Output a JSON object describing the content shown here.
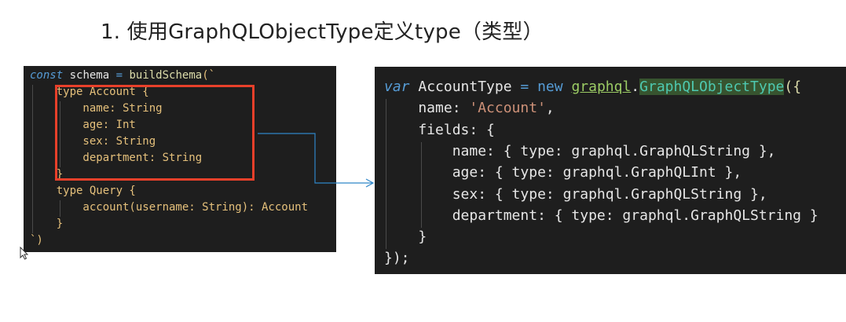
{
  "title": "1. 使用GraphQLObjectType定义type（类型）",
  "left_code": {
    "line1_kw": "const",
    "line1_var": " schema ",
    "line1_eq": "=",
    "line1_fn": " buildSchema",
    "line1_paren": "(`",
    "lines": [
      "    type Account {",
      "        name: String",
      "        age: Int",
      "        sex: String",
      "        department: String",
      "    }",
      "    type Query {",
      "        account(username: String): Account",
      "    }",
      "`)"
    ]
  },
  "right_code": {
    "l1_var": "var",
    "l1_name": " AccountType ",
    "l1_eq": "=",
    "l1_new": " new ",
    "l1_obj": "graphql",
    "l1_dot": ".",
    "l1_type": "GraphQLObjectType",
    "l1_end": "({",
    "l2_key": "    name: ",
    "l2_val": "'Account'",
    "l2_end": ",",
    "l3": "    fields: {",
    "l4": "        name: { type: graphql.GraphQLString },",
    "l5": "        age: { type: graphql.GraphQLInt },",
    "l6": "        sex: { type: graphql.GraphQLString },",
    "l7": "        department: { type: graphql.GraphQLString }",
    "l8": "    }",
    "l9": "});"
  },
  "colors": {
    "accent_box": "#e8402a",
    "arrow": "#2f86c8"
  }
}
